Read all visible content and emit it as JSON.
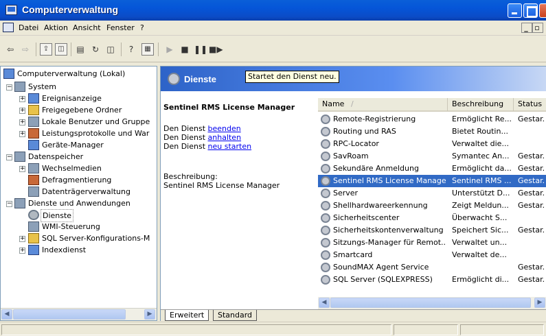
{
  "window": {
    "title": "Computerverwaltung"
  },
  "menu": {
    "items": [
      "Datei",
      "Aktion",
      "Ansicht",
      "Fenster",
      "?"
    ],
    "mdi_buttons": [
      "_",
      "̅"
    ]
  },
  "tree": {
    "root": "Computerverwaltung (Lokal)",
    "nodes": [
      {
        "label": "System"
      },
      {
        "label": "Ereignisanzeige"
      },
      {
        "label": "Freigegebene Ordner"
      },
      {
        "label": "Lokale Benutzer und Gruppe"
      },
      {
        "label": "Leistungsprotokolle und War"
      },
      {
        "label": "Geräte-Manager"
      },
      {
        "label": "Datenspeicher"
      },
      {
        "label": "Wechselmedien"
      },
      {
        "label": "Defragmentierung"
      },
      {
        "label": "Datenträgerverwaltung"
      },
      {
        "label": "Dienste und Anwendungen"
      },
      {
        "label": "Dienste"
      },
      {
        "label": "WMI-Steuerung"
      },
      {
        "label": "SQL Server-Konfigurations-M"
      },
      {
        "label": "Indexdienst"
      }
    ]
  },
  "pane": {
    "title": "Dienste",
    "tooltip": "Startet den Dienst neu.",
    "service_title": "Sentinel RMS License Manager",
    "action_prefix": "Den Dienst",
    "actions": [
      "beenden",
      "anhalten",
      "neu starten"
    ],
    "desc_label": "Beschreibung:",
    "desc_value": "Sentinel RMS License Manager"
  },
  "list": {
    "headers": [
      "Name",
      "Beschreibung",
      "Status"
    ],
    "sort_arrow": "/",
    "rows": [
      {
        "name": "Remote-Registrierung",
        "desc": "Ermöglicht Re...",
        "status": "Gestar."
      },
      {
        "name": "Routing und RAS",
        "desc": "Bietet Routin...",
        "status": ""
      },
      {
        "name": "RPC-Locator",
        "desc": "Verwaltet die...",
        "status": ""
      },
      {
        "name": "SavRoam",
        "desc": "Symantec An...",
        "status": "Gestar."
      },
      {
        "name": "Sekundäre Anmeldung",
        "desc": "Ermöglicht da...",
        "status": "Gestar."
      },
      {
        "name": "Sentinel RMS License Manager",
        "desc": "Sentinel RMS ...",
        "status": "Gestar."
      },
      {
        "name": "Server",
        "desc": "Unterstützt D...",
        "status": "Gestar."
      },
      {
        "name": "Shellhardwareerkennung",
        "desc": "Zeigt Meldun...",
        "status": "Gestar."
      },
      {
        "name": "Sicherheitscenter",
        "desc": "Überwacht S...",
        "status": ""
      },
      {
        "name": "Sicherheitskontenverwaltung",
        "desc": "Speichert Sic...",
        "status": "Gestar."
      },
      {
        "name": "Sitzungs-Manager für Remot...",
        "desc": "Verwaltet un...",
        "status": ""
      },
      {
        "name": "Smartcard",
        "desc": "Verwaltet de...",
        "status": ""
      },
      {
        "name": "SoundMAX Agent Service",
        "desc": "",
        "status": "Gestar."
      },
      {
        "name": "SQL Server (SQLEXPRESS)",
        "desc": "Ermöglicht di...",
        "status": "Gestar."
      }
    ],
    "selected_index": 5
  },
  "tabs": [
    "Erweitert",
    "Standard"
  ],
  "colors": {
    "title_blue": "#0a5fd8",
    "selection": "#316ac5",
    "link": "#0000ee"
  }
}
